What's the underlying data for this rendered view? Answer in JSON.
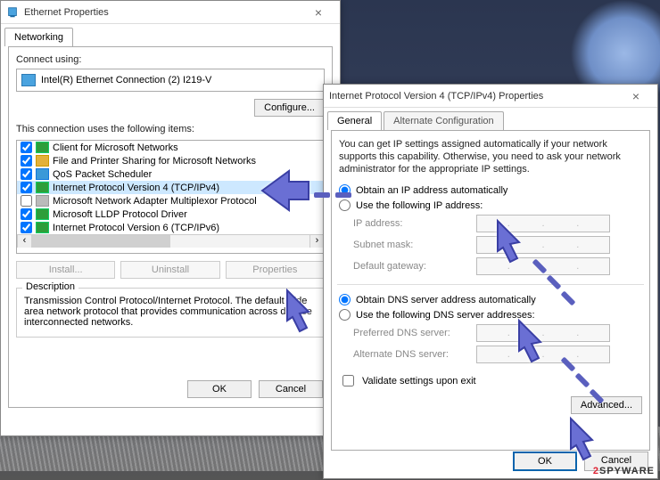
{
  "eth": {
    "title": "Ethernet Properties",
    "tab_networking": "Networking",
    "connect_using_label": "Connect using:",
    "adapter": "Intel(R) Ethernet Connection (2) I219-V",
    "configure": "Configure...",
    "items_label": "This connection uses the following items:",
    "items": [
      {
        "checked": true,
        "icon": "ic-net",
        "text": "Client for Microsoft Networks"
      },
      {
        "checked": true,
        "icon": "ic-share",
        "text": "File and Printer Sharing for Microsoft Networks"
      },
      {
        "checked": true,
        "icon": "ic-qos",
        "text": "QoS Packet Scheduler"
      },
      {
        "checked": true,
        "icon": "ic-net",
        "text": "Internet Protocol Version 4 (TCP/IPv4)"
      },
      {
        "checked": false,
        "icon": "ic-mux",
        "text": "Microsoft Network Adapter Multiplexor Protocol"
      },
      {
        "checked": true,
        "icon": "ic-net",
        "text": "Microsoft LLDP Protocol Driver"
      },
      {
        "checked": true,
        "icon": "ic-net",
        "text": "Internet Protocol Version 6 (TCP/IPv6)"
      }
    ],
    "install": "Install...",
    "uninstall": "Uninstall",
    "properties": "Properties",
    "desc_legend": "Description",
    "desc_text": "Transmission Control Protocol/Internet Protocol. The default wide area network protocol that provides communication across diverse interconnected networks.",
    "ok": "OK",
    "cancel": "Cancel"
  },
  "ipv4": {
    "title": "Internet Protocol Version 4 (TCP/IPv4) Properties",
    "tab_general": "General",
    "tab_alt": "Alternate Configuration",
    "intro": "You can get IP settings assigned automatically if your network supports this capability. Otherwise, you need to ask your network administrator for the appropriate IP settings.",
    "r_auto": "Obtain an IP address automatically",
    "r_static": "Use the following IP address:",
    "f_ip": "IP address:",
    "f_mask": "Subnet mask:",
    "f_gw": "Default gateway:",
    "r_dns_auto": "Obtain DNS server address automatically",
    "r_dns_static": "Use the following DNS server addresses:",
    "f_pdns": "Preferred DNS server:",
    "f_adns": "Alternate DNS server:",
    "validate": "Validate settings upon exit",
    "advanced": "Advanced...",
    "ok": "OK",
    "cancel": "Cancel"
  },
  "watermark": "SPYWARE"
}
